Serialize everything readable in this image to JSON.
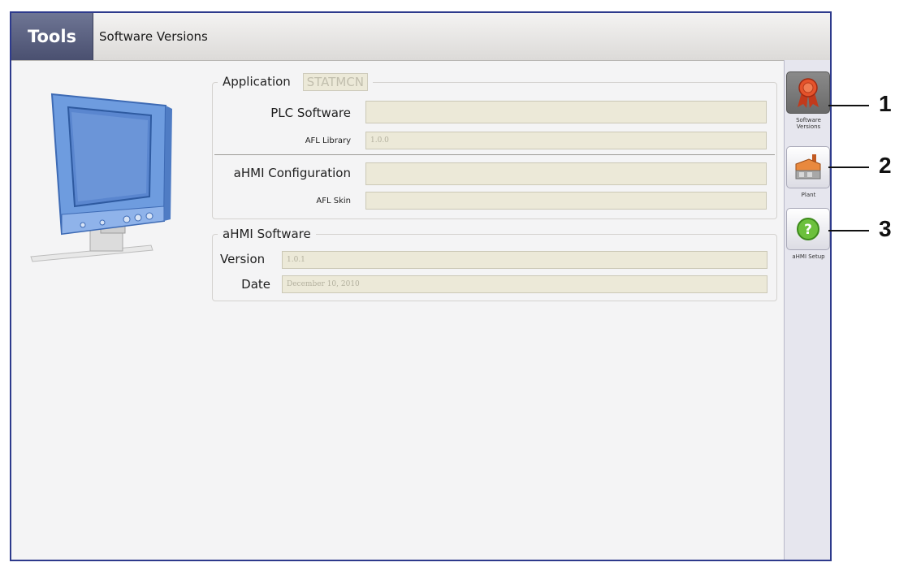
{
  "header": {
    "tab": "Tools",
    "title": "Software Versions"
  },
  "application": {
    "legend": "Application",
    "app_name": "STATMCN",
    "plc_software_label": "PLC Software",
    "plc_software_value": "",
    "afl_library_label": "AFL Library",
    "afl_library_value": "1.0.0",
    "ahmi_config_label": "aHMI Configuration",
    "ahmi_config_value": "",
    "afl_skin_label": "AFL Skin",
    "afl_skin_value": ""
  },
  "ahmi_software": {
    "legend": "aHMI Software",
    "version_label": "Version",
    "version_value": "1.0.1",
    "date_label": "Date",
    "date_value": "December 10, 2010"
  },
  "sidebar": {
    "items": [
      {
        "label": "Software Versions",
        "icon": "award-ribbon-icon",
        "active": true
      },
      {
        "label": "Plant",
        "icon": "factory-icon",
        "active": false
      },
      {
        "label": "aHMI Setup",
        "icon": "help-icon",
        "active": false
      }
    ]
  },
  "callouts": [
    "1",
    "2",
    "3"
  ]
}
